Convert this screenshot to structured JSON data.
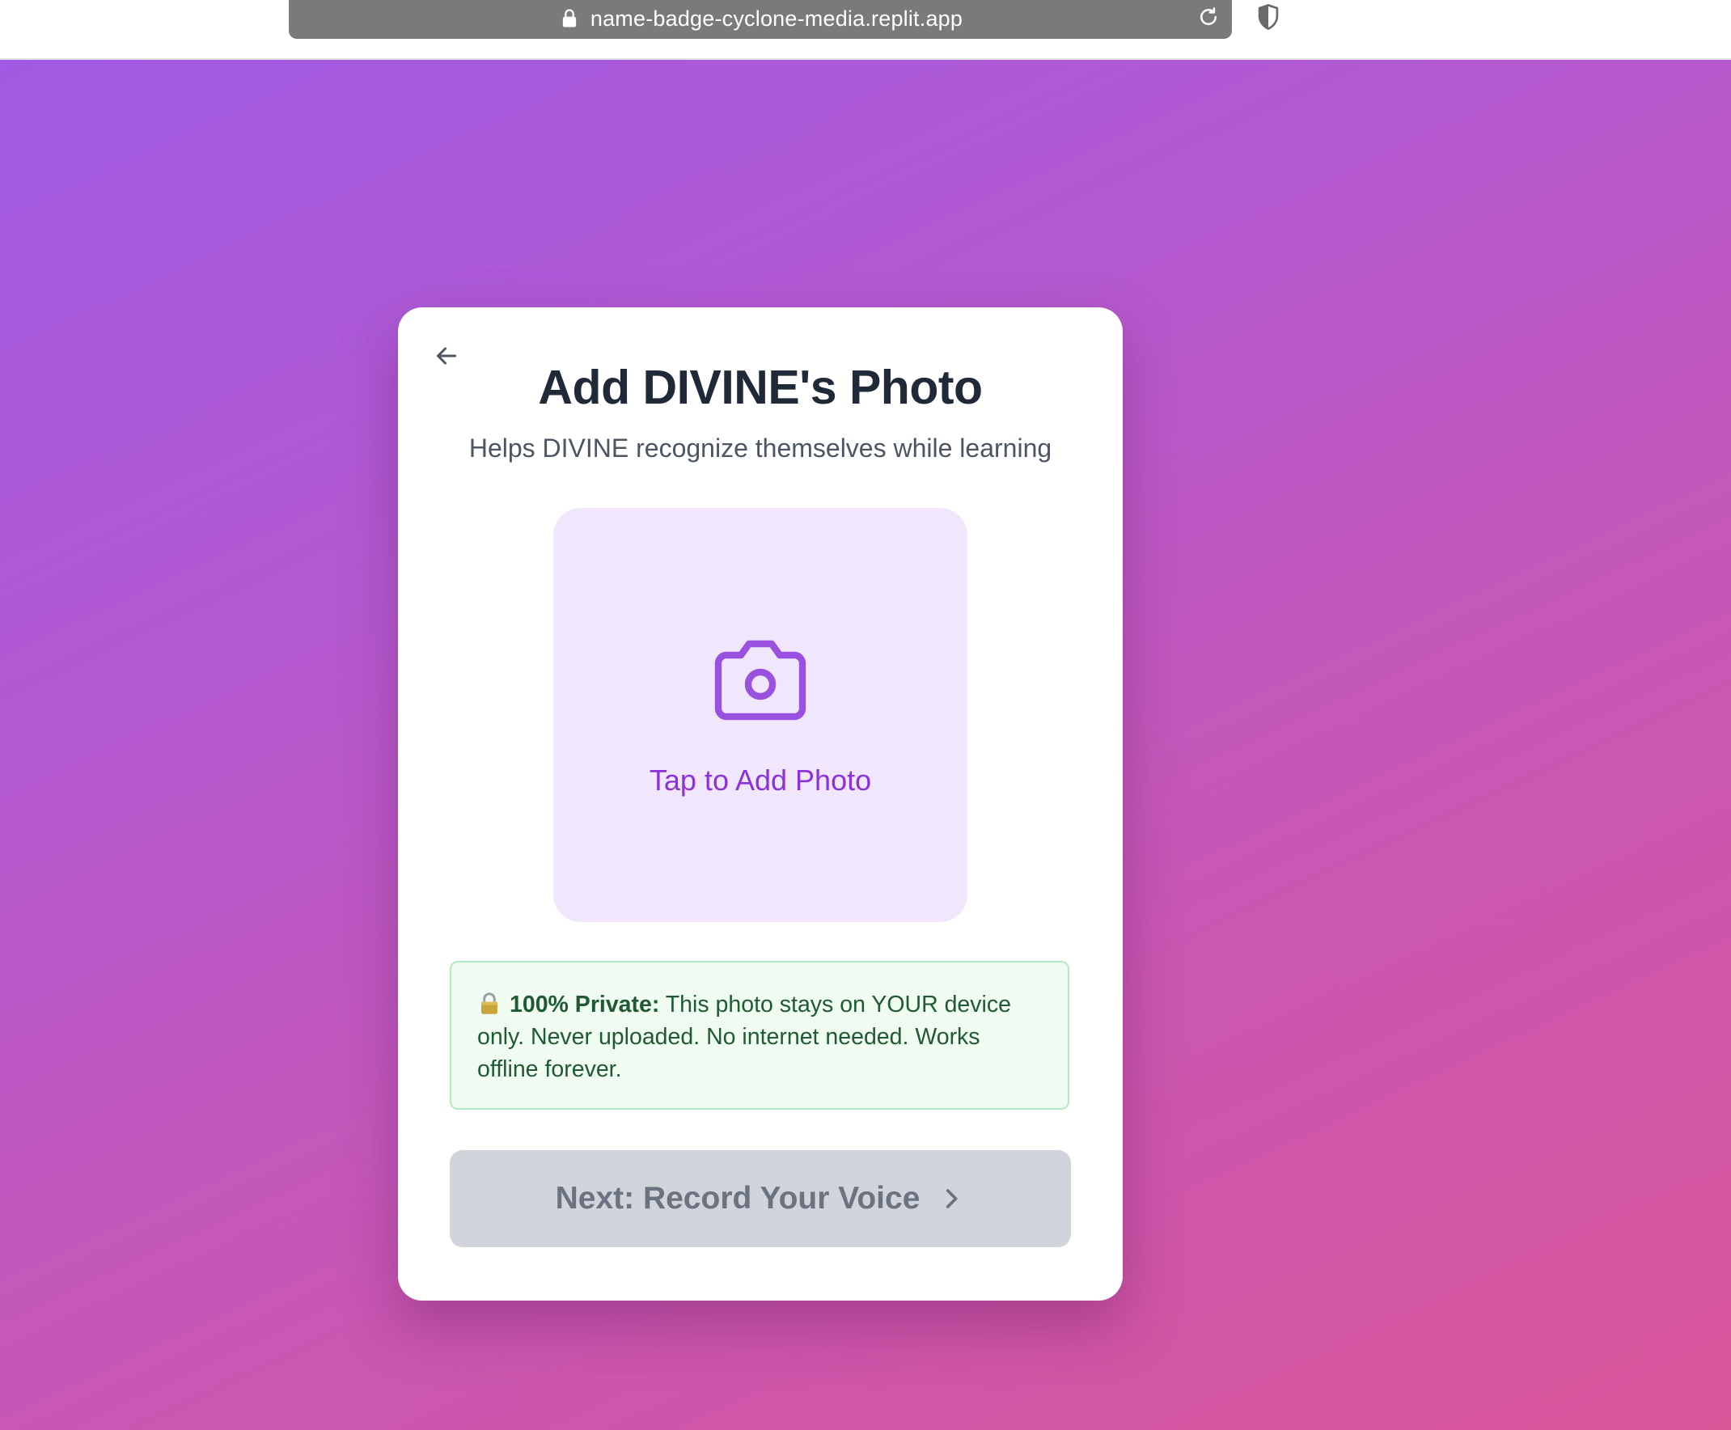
{
  "browser": {
    "url": "name-badge-cyclone-media.replit.app",
    "lock_icon": "lock-icon",
    "reload_icon": "reload-icon",
    "shield_icon": "shield-icon"
  },
  "page": {
    "gradient_start": "#a05ae3",
    "gradient_end": "#d95598"
  },
  "card": {
    "back_icon": "arrow-left-icon",
    "title": "Add DIVINE's Photo",
    "subtitle": "Helps DIVINE recognize themselves while learning",
    "photo_upload": {
      "icon": "camera-icon",
      "label": "Tap to Add Photo",
      "accent_color": "#8b32d8",
      "background": "#f0e7fc"
    },
    "privacy_notice": {
      "icon": "lock-emoji",
      "emoji": "🔒",
      "heading": "100% Private:",
      "text": " This photo stays on YOUR device only. Never uploaded. No internet needed. Works offline forever."
    },
    "next_button": {
      "label": "Next: Record Your Voice",
      "icon": "chevron-right-icon",
      "disabled": true
    }
  }
}
